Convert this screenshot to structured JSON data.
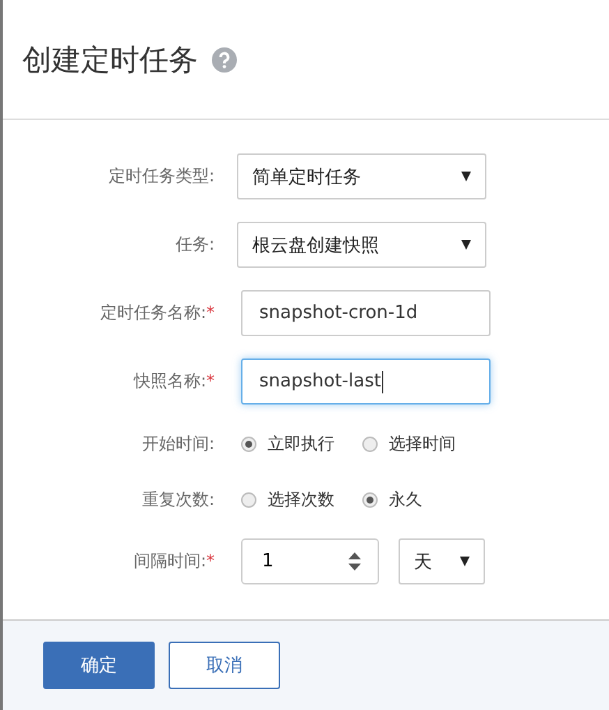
{
  "dialog": {
    "title": "创建定时任务"
  },
  "fields": [
    {
      "kind": "select",
      "label": "定时任务类型:",
      "value": "简单定时任务"
    },
    {
      "kind": "select",
      "label": "任务:",
      "value": "根云盘创建快照"
    },
    {
      "kind": "text",
      "label": "定时任务名称:",
      "required_mark": "*",
      "value": "snapshot-cron-1d",
      "focused": false
    },
    {
      "kind": "text",
      "label": "快照名称:",
      "required_mark": "*",
      "value": "snapshot-last",
      "focused": true
    },
    {
      "kind": "radio",
      "label": "开始时间:",
      "options": [
        {
          "label": "立即执行",
          "selected": true
        },
        {
          "label": "选择时间",
          "selected": false
        }
      ]
    },
    {
      "kind": "radio",
      "label": "重复次数:",
      "options": [
        {
          "label": "选择次数",
          "selected": false
        },
        {
          "label": "永久",
          "selected": true
        }
      ]
    },
    {
      "kind": "interval",
      "label": "间隔时间:",
      "required_mark": "*",
      "value": "1",
      "unit": "天"
    }
  ],
  "buttons": [
    {
      "label": "确定",
      "primary": true
    },
    {
      "label": "取消",
      "primary": false
    }
  ]
}
